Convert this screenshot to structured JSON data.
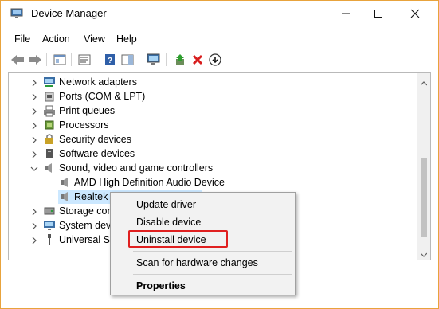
{
  "window": {
    "title": "Device Manager",
    "controls": {
      "minimize_icon": "minimize-icon",
      "maximize_icon": "maximize-icon",
      "close_icon": "close-icon"
    }
  },
  "menubar": {
    "items": [
      {
        "label": "File"
      },
      {
        "label": "Action"
      },
      {
        "label": "View"
      },
      {
        "label": "Help"
      }
    ]
  },
  "toolbar": {
    "buttons": [
      "back-icon",
      "forward-icon",
      "show-hide-tree-icon",
      "properties-icon",
      "help-icon",
      "action-pane-icon",
      "scan-hardware-icon",
      "update-driver-icon",
      "uninstall-icon",
      "disable-device-icon"
    ]
  },
  "tree": {
    "items": [
      {
        "label": "Network adapters",
        "expanded": false,
        "icon": "network-adapter-icon"
      },
      {
        "label": "Ports (COM & LPT)",
        "expanded": false,
        "icon": "port-icon"
      },
      {
        "label": "Print queues",
        "expanded": false,
        "icon": "printer-icon"
      },
      {
        "label": "Processors",
        "expanded": false,
        "icon": "processor-icon"
      },
      {
        "label": "Security devices",
        "expanded": false,
        "icon": "security-device-icon"
      },
      {
        "label": "Software devices",
        "expanded": false,
        "icon": "software-device-icon"
      },
      {
        "label": "Sound, video and game controllers",
        "expanded": true,
        "icon": "speaker-icon"
      },
      {
        "label": "AMD High Definition Audio Device",
        "child": true,
        "icon": "speaker-icon"
      },
      {
        "label": "Realtek I",
        "child": true,
        "selected": true,
        "icon": "speaker-icon"
      },
      {
        "label": "Storage con",
        "expanded": false,
        "icon": "storage-icon"
      },
      {
        "label": "System devi",
        "expanded": false,
        "icon": "system-device-icon"
      },
      {
        "label": "Universal Se",
        "expanded": false,
        "icon": "usb-icon"
      }
    ]
  },
  "context_menu": {
    "items": [
      {
        "label": "Update driver"
      },
      {
        "label": "Disable device"
      },
      {
        "label": "Uninstall device",
        "highlighted": true
      },
      {
        "label": "Scan for hardware changes"
      },
      {
        "label": "Properties",
        "bold": true
      }
    ]
  },
  "colors": {
    "window_border": "#e8a33c",
    "selection": "#cce8ff",
    "highlight_box": "#e02020",
    "menu_bg": "#f2f2f2"
  }
}
